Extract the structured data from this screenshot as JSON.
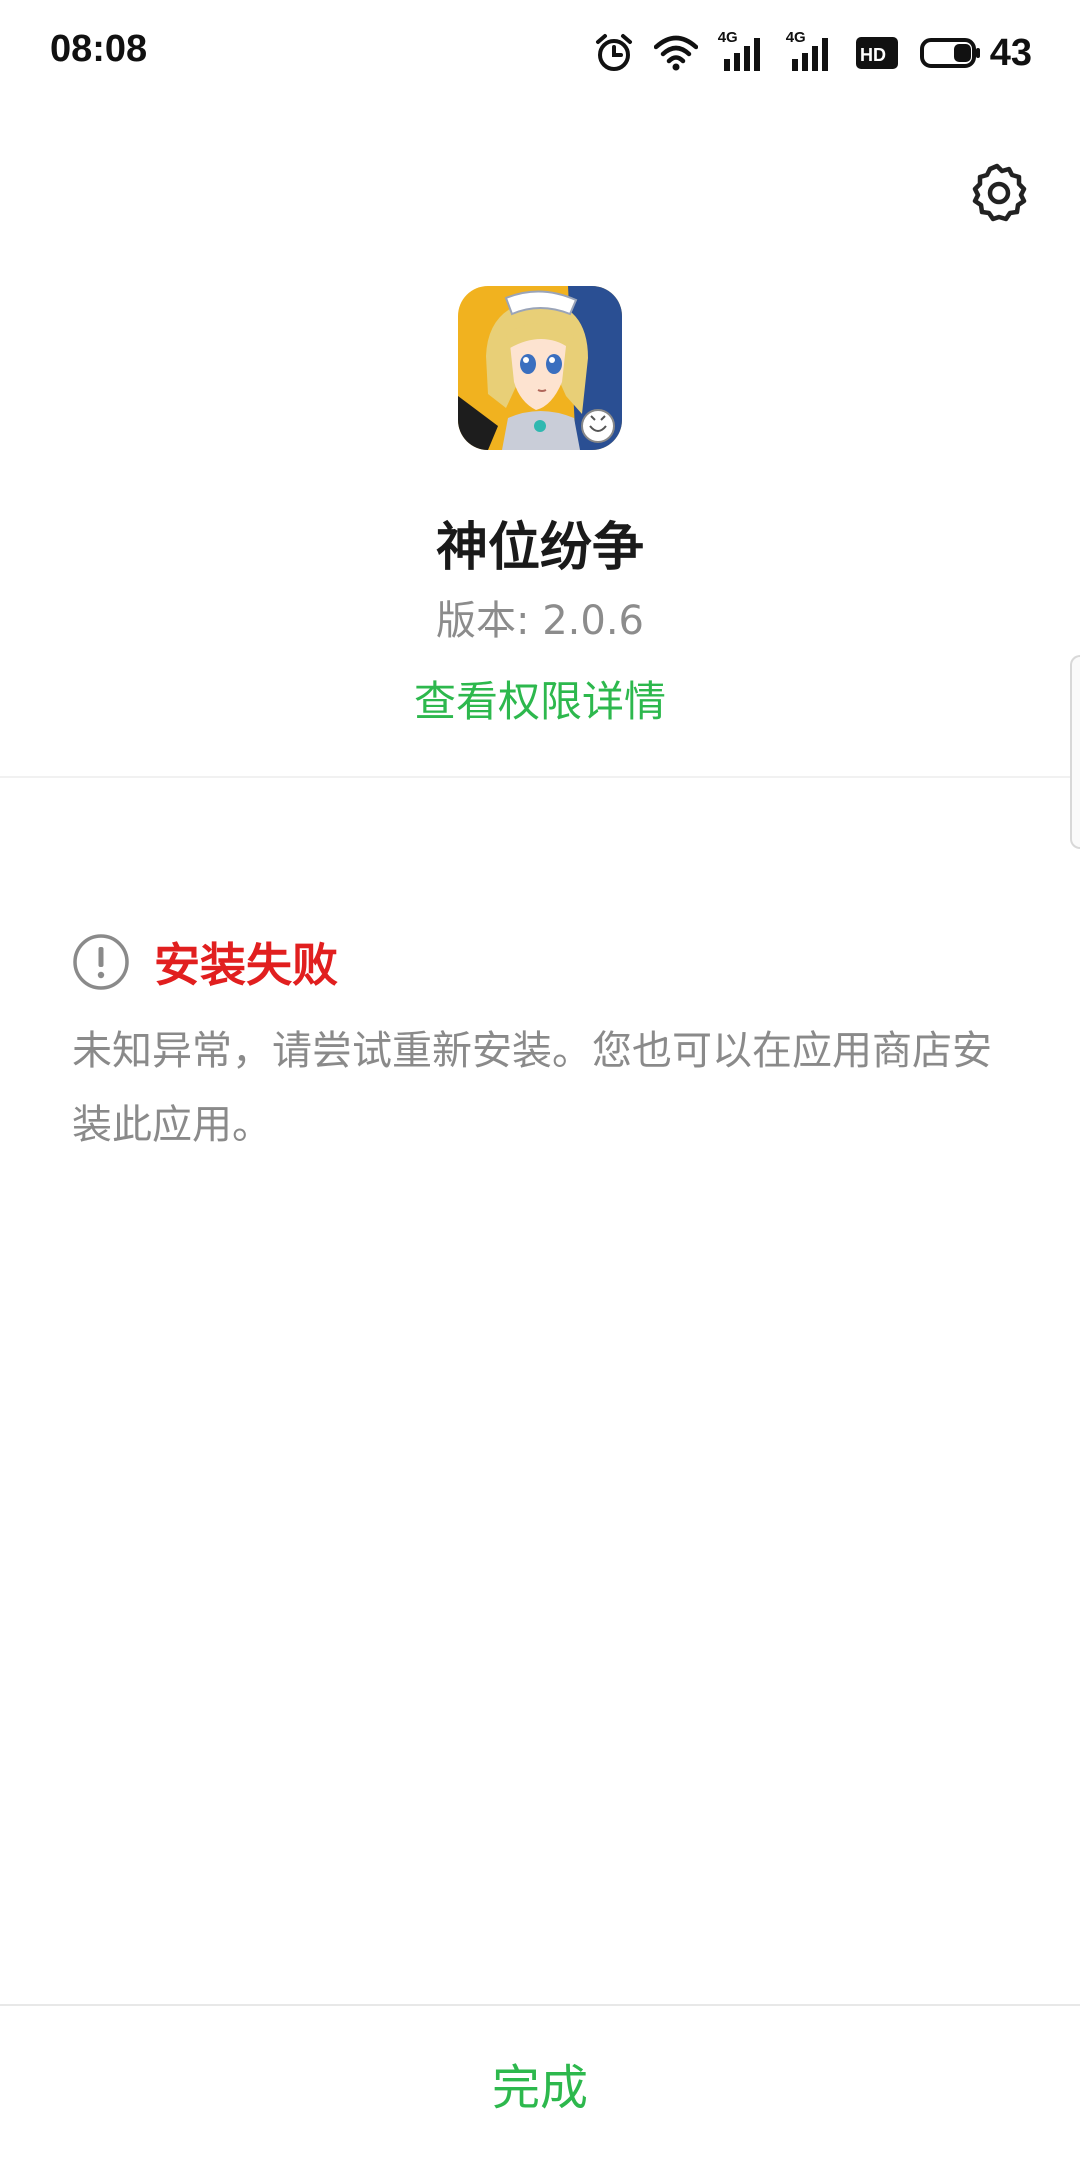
{
  "status_bar": {
    "time": "08:08",
    "network_1": "4G",
    "network_2": "4G",
    "battery_level": "43",
    "icons": [
      "alarm-icon",
      "wifi-icon",
      "signal-4g-icon",
      "signal-4g-icon",
      "hd-icon",
      "battery-icon"
    ]
  },
  "header": {
    "settings_icon": "gear-icon"
  },
  "app": {
    "name": "神位纷争",
    "version": "版本: 2.0.6",
    "permission_link": "查看权限详情"
  },
  "error": {
    "icon": "warning-icon",
    "title": "安装失败",
    "message": "未知异常，请尝试重新安装。您也可以在应用商店安装此应用。"
  },
  "footer": {
    "done_label": "完成"
  },
  "colors": {
    "accent_green": "#2db84d",
    "error_red": "#e11f1f",
    "secondary_text": "#8a8a8a"
  }
}
